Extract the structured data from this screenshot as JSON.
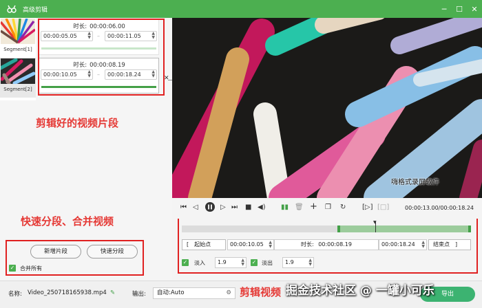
{
  "window": {
    "title": "高级剪辑",
    "controls": [
      "minimize-icon",
      "restore-icon",
      "close-icon"
    ]
  },
  "segments": [
    {
      "label": "Segment[1]",
      "duration_label": "时长:",
      "duration": "00:00:06.00",
      "start": "00:00:05.05",
      "end": "00:00:11.05",
      "dash": "–"
    },
    {
      "label": "Segment[2]",
      "duration_label": "时长:",
      "duration": "00:00:08.19",
      "start": "00:00:10.05",
      "end": "00:00:18.24",
      "dash": "–"
    }
  ],
  "annotations": {
    "clips": "剪辑好的视频片段",
    "split_merge": "快速分段、合并视频",
    "edit_video": "剪辑视频"
  },
  "buttons": {
    "add_segment": "新增片段",
    "quick_split": "快速分段"
  },
  "merge_all": {
    "label": "合并所有",
    "checked": true
  },
  "player": {
    "watermark": "嗨格式录屏软件",
    "time_display": "00:00:13.00/00:00:18.24"
  },
  "editor": {
    "start_btn": "[　起始点",
    "start_value": "00:00:10.05",
    "duration_label": "时长:",
    "duration_value": "00:00:08.19",
    "end_value": "00:00:18.24",
    "end_btn": "结束点　]",
    "fade_in_label": "淡入",
    "fade_in_value": "1.9",
    "fade_out_label": "淡出",
    "fade_out_value": "1.9",
    "trim_position": 0.7,
    "cursor_position": 0.67
  },
  "footer": {
    "name_label": "名称:",
    "file_name": "Video_250718165938.mp4",
    "output_label": "输出:",
    "output_value": "自动:Auto",
    "export": "导出"
  },
  "overlay_watermark": "掘金技术社区 @ 一罐小可乐",
  "colors": {
    "accent": "#4caf50",
    "annotation_red": "#e53935"
  }
}
